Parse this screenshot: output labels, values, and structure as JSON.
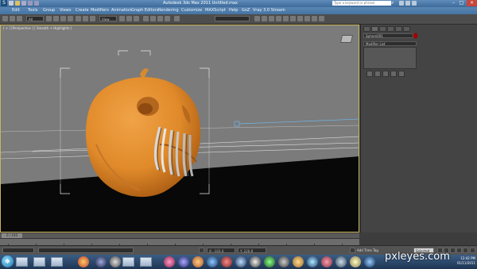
{
  "window": {
    "title": "Autodesk 3ds Max 2011    Untitled.max",
    "search_placeholder": "Type a keyword or phrase"
  },
  "menus": [
    "Edit",
    "Tools",
    "Group",
    "Views",
    "Create",
    "Modifiers",
    "Animation",
    "Graph Editors",
    "Rendering",
    "Customize",
    "MAXScript",
    "Help",
    "GoZ",
    "Vray 3.0 Stream"
  ],
  "toolbar": {
    "selection_filter": "All",
    "ref_coord": "View"
  },
  "viewport": {
    "label": "[ + ] [Perspective ] [ Smooth + Highlights ]"
  },
  "command_panel": {
    "object_name": "Sphere001",
    "modifier_list": "Modifier List",
    "object_color": "#a00000"
  },
  "timeline": {
    "frame_label": "0 / 100"
  },
  "status": {
    "coords_x": "X: -103.4",
    "coords_y": "Y: 226.8",
    "selected_label": "Selected",
    "add_time_tag": "Add Time Tag"
  },
  "taskbar": {
    "clock": "12:42 PM",
    "date": "01/11/2011"
  },
  "watermark": "pxleyes.com"
}
